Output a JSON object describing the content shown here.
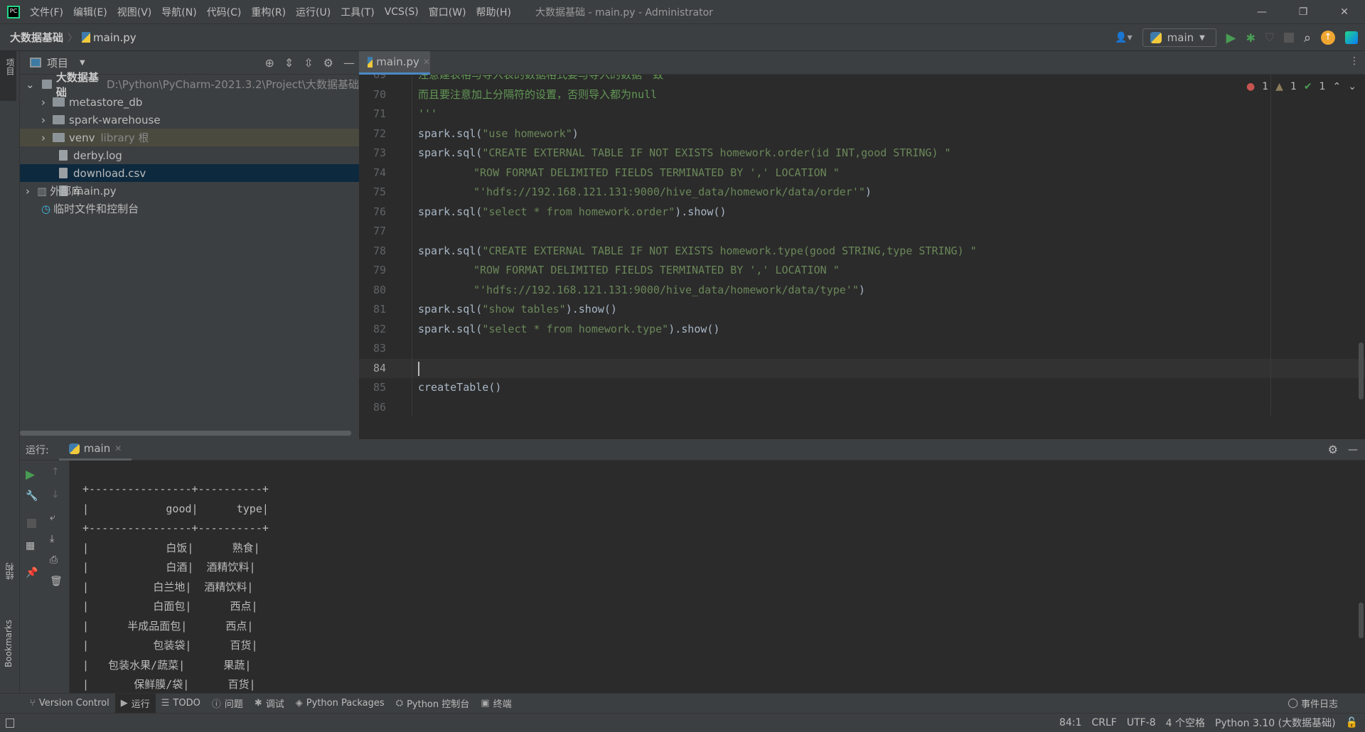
{
  "titlebar": {
    "menu": [
      "文件(F)",
      "编辑(E)",
      "视图(V)",
      "导航(N)",
      "代码(C)",
      "重构(R)",
      "运行(U)",
      "工具(T)",
      "VCS(S)",
      "窗口(W)",
      "帮助(H)"
    ],
    "title": "大数据基础 - main.py - Administrator"
  },
  "navbar": {
    "breadcrumb": [
      "大数据基础",
      "main.py"
    ],
    "run_config": "main"
  },
  "project": {
    "header": "项目",
    "root": {
      "name": "大数据基础",
      "path": "D:\\Python\\PyCharm-2021.3.2\\Project\\大数据基础"
    },
    "items": [
      {
        "name": "metastore_db",
        "type": "folder"
      },
      {
        "name": "spark-warehouse",
        "type": "folder"
      },
      {
        "name": "venv",
        "type": "folder",
        "hint": "library 根"
      },
      {
        "name": "derby.log",
        "type": "file"
      },
      {
        "name": "download.csv",
        "type": "file",
        "selected": true
      },
      {
        "name": "main.py",
        "type": "file"
      }
    ],
    "external": "外部库",
    "scratches": "临时文件和控制台"
  },
  "editor": {
    "tab": "main.py",
    "inspections": {
      "errors": "1",
      "warnings": "1",
      "weak": "1"
    },
    "lines": [
      {
        "n": "69",
        "code": "注意建表格与导入表的数据格式要与导入的数据一致",
        "kind": "comment",
        "indent": 1
      },
      {
        "n": "70",
        "code": "而且要注意加上分隔符的设置，否则导入都为null",
        "kind": "comment",
        "indent": 1
      },
      {
        "n": "71",
        "code": "'''",
        "kind": "comment",
        "indent": 1
      },
      {
        "n": "72",
        "pre": "spark.sql(",
        "str": "\"use homework\"",
        "post": ")",
        "indent": 1
      },
      {
        "n": "73",
        "pre": "spark.sql(",
        "str": "\"CREATE EXTERNAL TABLE IF NOT EXISTS homework.order(id INT,good STRING) \"",
        "post": "",
        "indent": 1
      },
      {
        "n": "74",
        "pre": "",
        "str": "\"ROW FORMAT DELIMITED FIELDS TERMINATED BY ',' LOCATION \"",
        "post": "",
        "indent": 3
      },
      {
        "n": "75",
        "pre": "",
        "str": "\"'hdfs://192.168.121.131:9000/hive_data/homework/data/order'\"",
        "post": ")",
        "indent": 3
      },
      {
        "n": "76",
        "pre": "spark.sql(",
        "str": "\"select * from homework.order\"",
        "post": ").show()",
        "indent": 1
      },
      {
        "n": "77",
        "pre": "",
        "str": "",
        "post": "",
        "indent": 0
      },
      {
        "n": "78",
        "pre": "spark.sql(",
        "str": "\"CREATE EXTERNAL TABLE IF NOT EXISTS homework.type(good STRING,type STRING) \"",
        "post": "",
        "indent": 1
      },
      {
        "n": "79",
        "pre": "",
        "str": "\"ROW FORMAT DELIMITED FIELDS TERMINATED BY ',' LOCATION \"",
        "post": "",
        "indent": 3
      },
      {
        "n": "80",
        "pre": "",
        "str": "\"'hdfs://192.168.121.131:9000/hive_data/homework/data/type'\"",
        "post": ")",
        "indent": 3
      },
      {
        "n": "81",
        "pre": "spark.sql(",
        "str": "\"show tables\"",
        "post": ").show()",
        "indent": 1
      },
      {
        "n": "82",
        "pre": "spark.sql(",
        "str": "\"select * from homework.type\"",
        "post": ").show()",
        "indent": 1
      },
      {
        "n": "83",
        "pre": "",
        "str": "",
        "post": "",
        "indent": 0
      },
      {
        "n": "84",
        "pre": "",
        "str": "",
        "post": "",
        "indent": 0,
        "current": true
      },
      {
        "n": "85",
        "pre": "createTable()",
        "str": "",
        "post": "",
        "indent": 0
      },
      {
        "n": "86",
        "pre": "",
        "str": "",
        "post": "",
        "indent": 0
      }
    ]
  },
  "run": {
    "label": "运行:",
    "tab": "main",
    "console": [
      "+----------------+----------+",
      "|            good|      type|",
      "+----------------+----------+",
      "|            白饭|      熟食|",
      "|            白酒|  酒精饮料|",
      "|          白兰地|  酒精饮料|",
      "|          白面包|      西点|",
      "|      半成品面包|      西点|",
      "|          包装袋|      百货|",
      "|   包装水果/蔬菜|      果蔬|",
      "|       保鲜膜/袋|      百货|"
    ]
  },
  "side": {
    "project": "项目",
    "structure": "结构",
    "bookmarks": "Bookmarks"
  },
  "toolwindows": [
    "Version Control",
    "运行",
    "TODO",
    "问题",
    "调试",
    "Python Packages",
    "Python 控制台",
    "终端"
  ],
  "event_log": "事件日志",
  "status": {
    "position": "84:1",
    "line_sep": "CRLF",
    "encoding": "UTF-8",
    "indent": "4 个空格",
    "interpreter": "Python 3.10 (大数据基础)"
  }
}
